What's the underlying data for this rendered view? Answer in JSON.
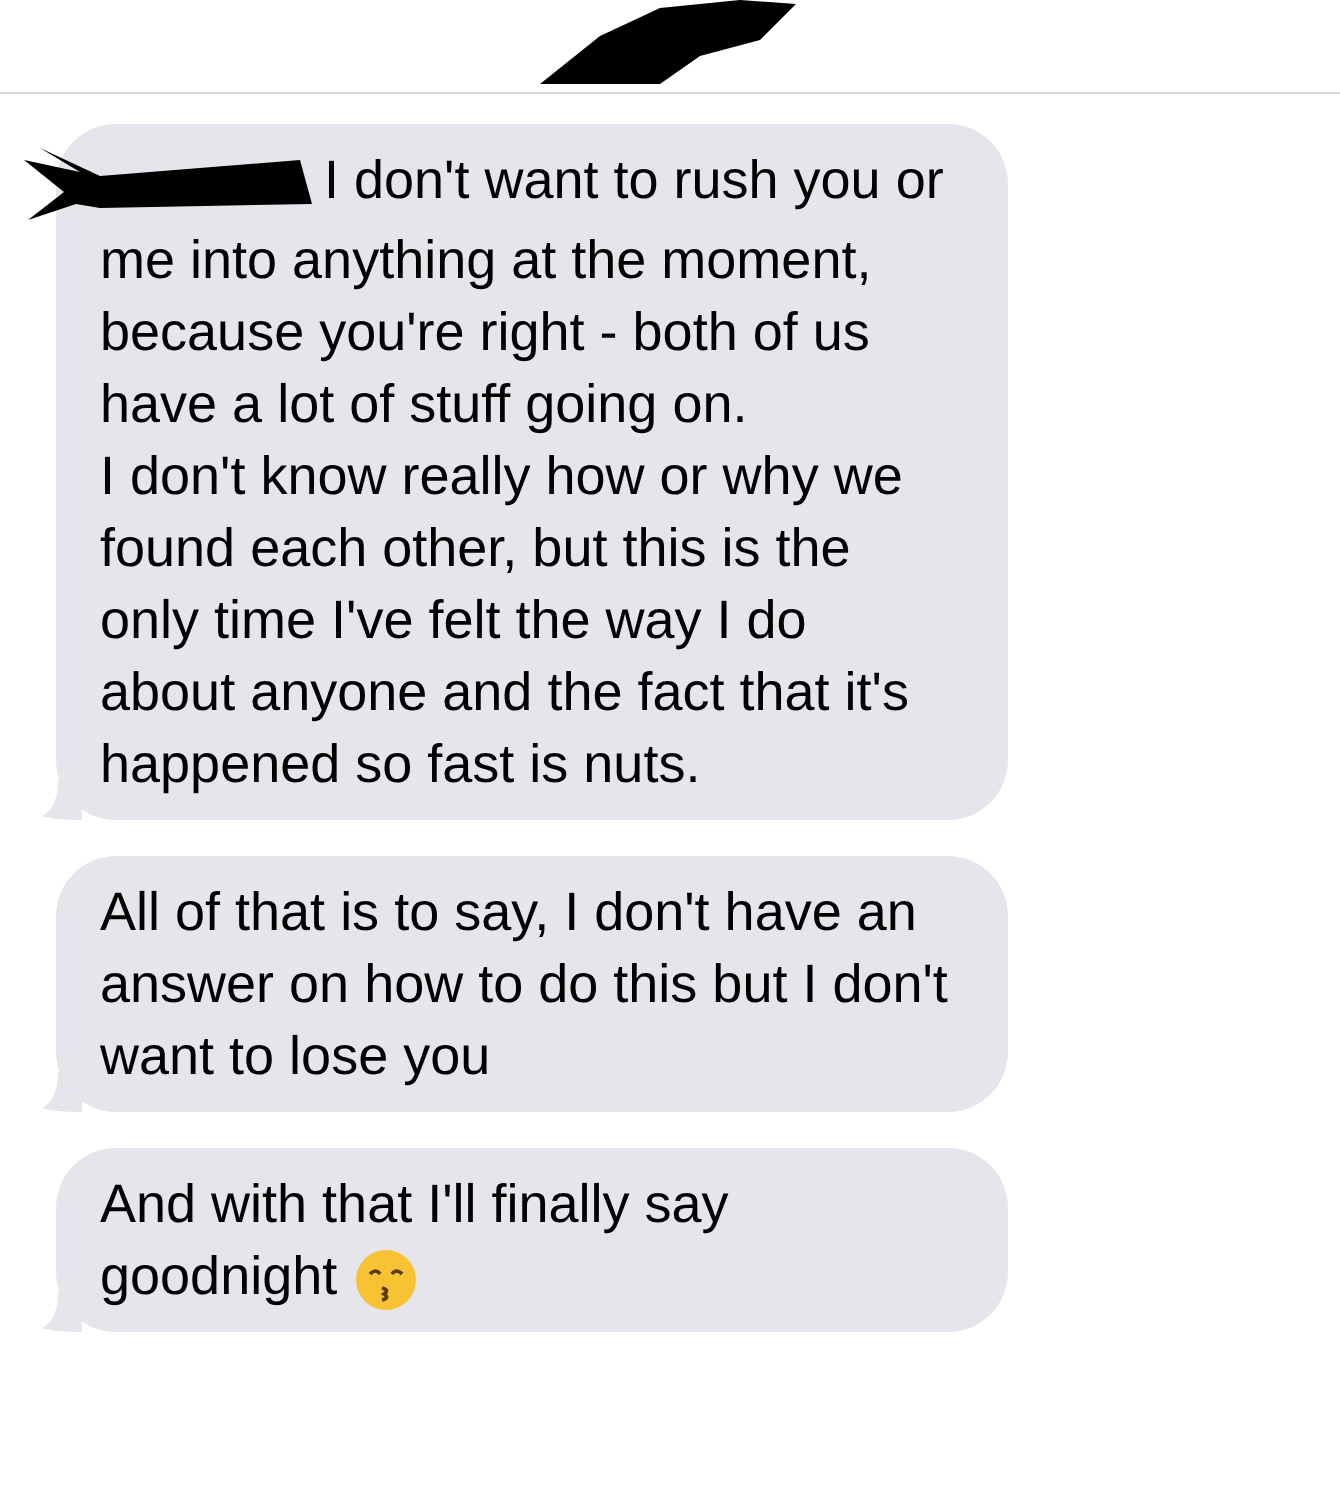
{
  "header": {
    "redacted": true
  },
  "messages": [
    {
      "text": "I don't want to rush you or me into anything at the moment, because you're right - both of us have a lot of stuff going on.\nI don't know really how or why we found each other, but this is the only time I've felt the way I do about anyone and the fact that it's happened so fast is nuts.",
      "redacted_start": true,
      "emoji": false
    },
    {
      "text": "All of that is to say, I don't have an answer on how to do this but I don't want to lose you",
      "redacted_start": false,
      "emoji": false
    },
    {
      "text": "And with that I'll finally say goodnight",
      "redacted_start": false,
      "emoji": true
    }
  ]
}
